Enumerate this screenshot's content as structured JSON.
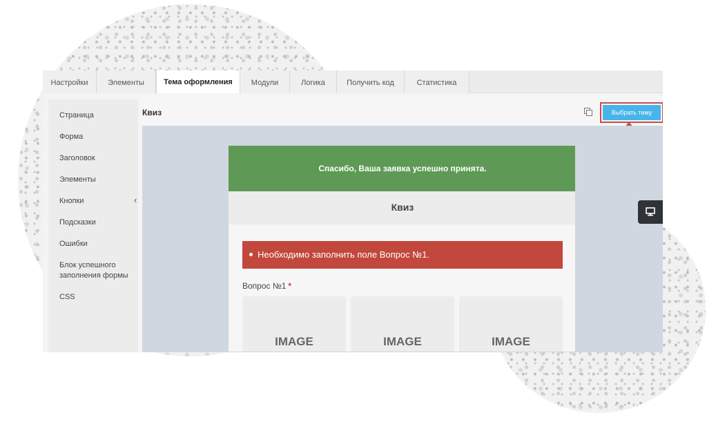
{
  "tabs": [
    {
      "label": "Настройки",
      "active": false
    },
    {
      "label": "Элементы",
      "active": false
    },
    {
      "label": "Тема оформления",
      "active": true
    },
    {
      "label": "Модули",
      "active": false
    },
    {
      "label": "Логика",
      "active": false
    },
    {
      "label": "Получить код",
      "active": false
    },
    {
      "label": "Статистика",
      "active": false
    }
  ],
  "sidebar": {
    "items": [
      {
        "label": "Страница"
      },
      {
        "label": "Форма"
      },
      {
        "label": "Заголовок"
      },
      {
        "label": "Элементы"
      },
      {
        "label": "Кнопки"
      },
      {
        "label": "Подсказки"
      },
      {
        "label": "Ошибки"
      },
      {
        "label": "Блок успешного заполнения формы"
      },
      {
        "label": "CSS"
      }
    ],
    "chevron": "‹"
  },
  "main": {
    "title": "Квиз",
    "copy_icon": "copy-icon",
    "theme_button_label": "Выбрать тему"
  },
  "preview": {
    "success_message": "Спасибо, Ваша заявка успешно принята.",
    "quiz_title": "Квиз",
    "error_message": "Необходимо заполнить поле Вопрос №1.",
    "question_label": "Вопрос №1",
    "required_mark": "*",
    "image_cards": [
      {
        "label": "IMAGE"
      },
      {
        "label": "IMAGE"
      },
      {
        "label": "IMAGE"
      }
    ]
  },
  "device_icon": "monitor-icon",
  "colors": {
    "accent": "#47b4ea",
    "success": "#5e9a55",
    "error": "#c2473d",
    "highlight": "#c94b4b",
    "preview_bg": "#cfd7e0"
  }
}
